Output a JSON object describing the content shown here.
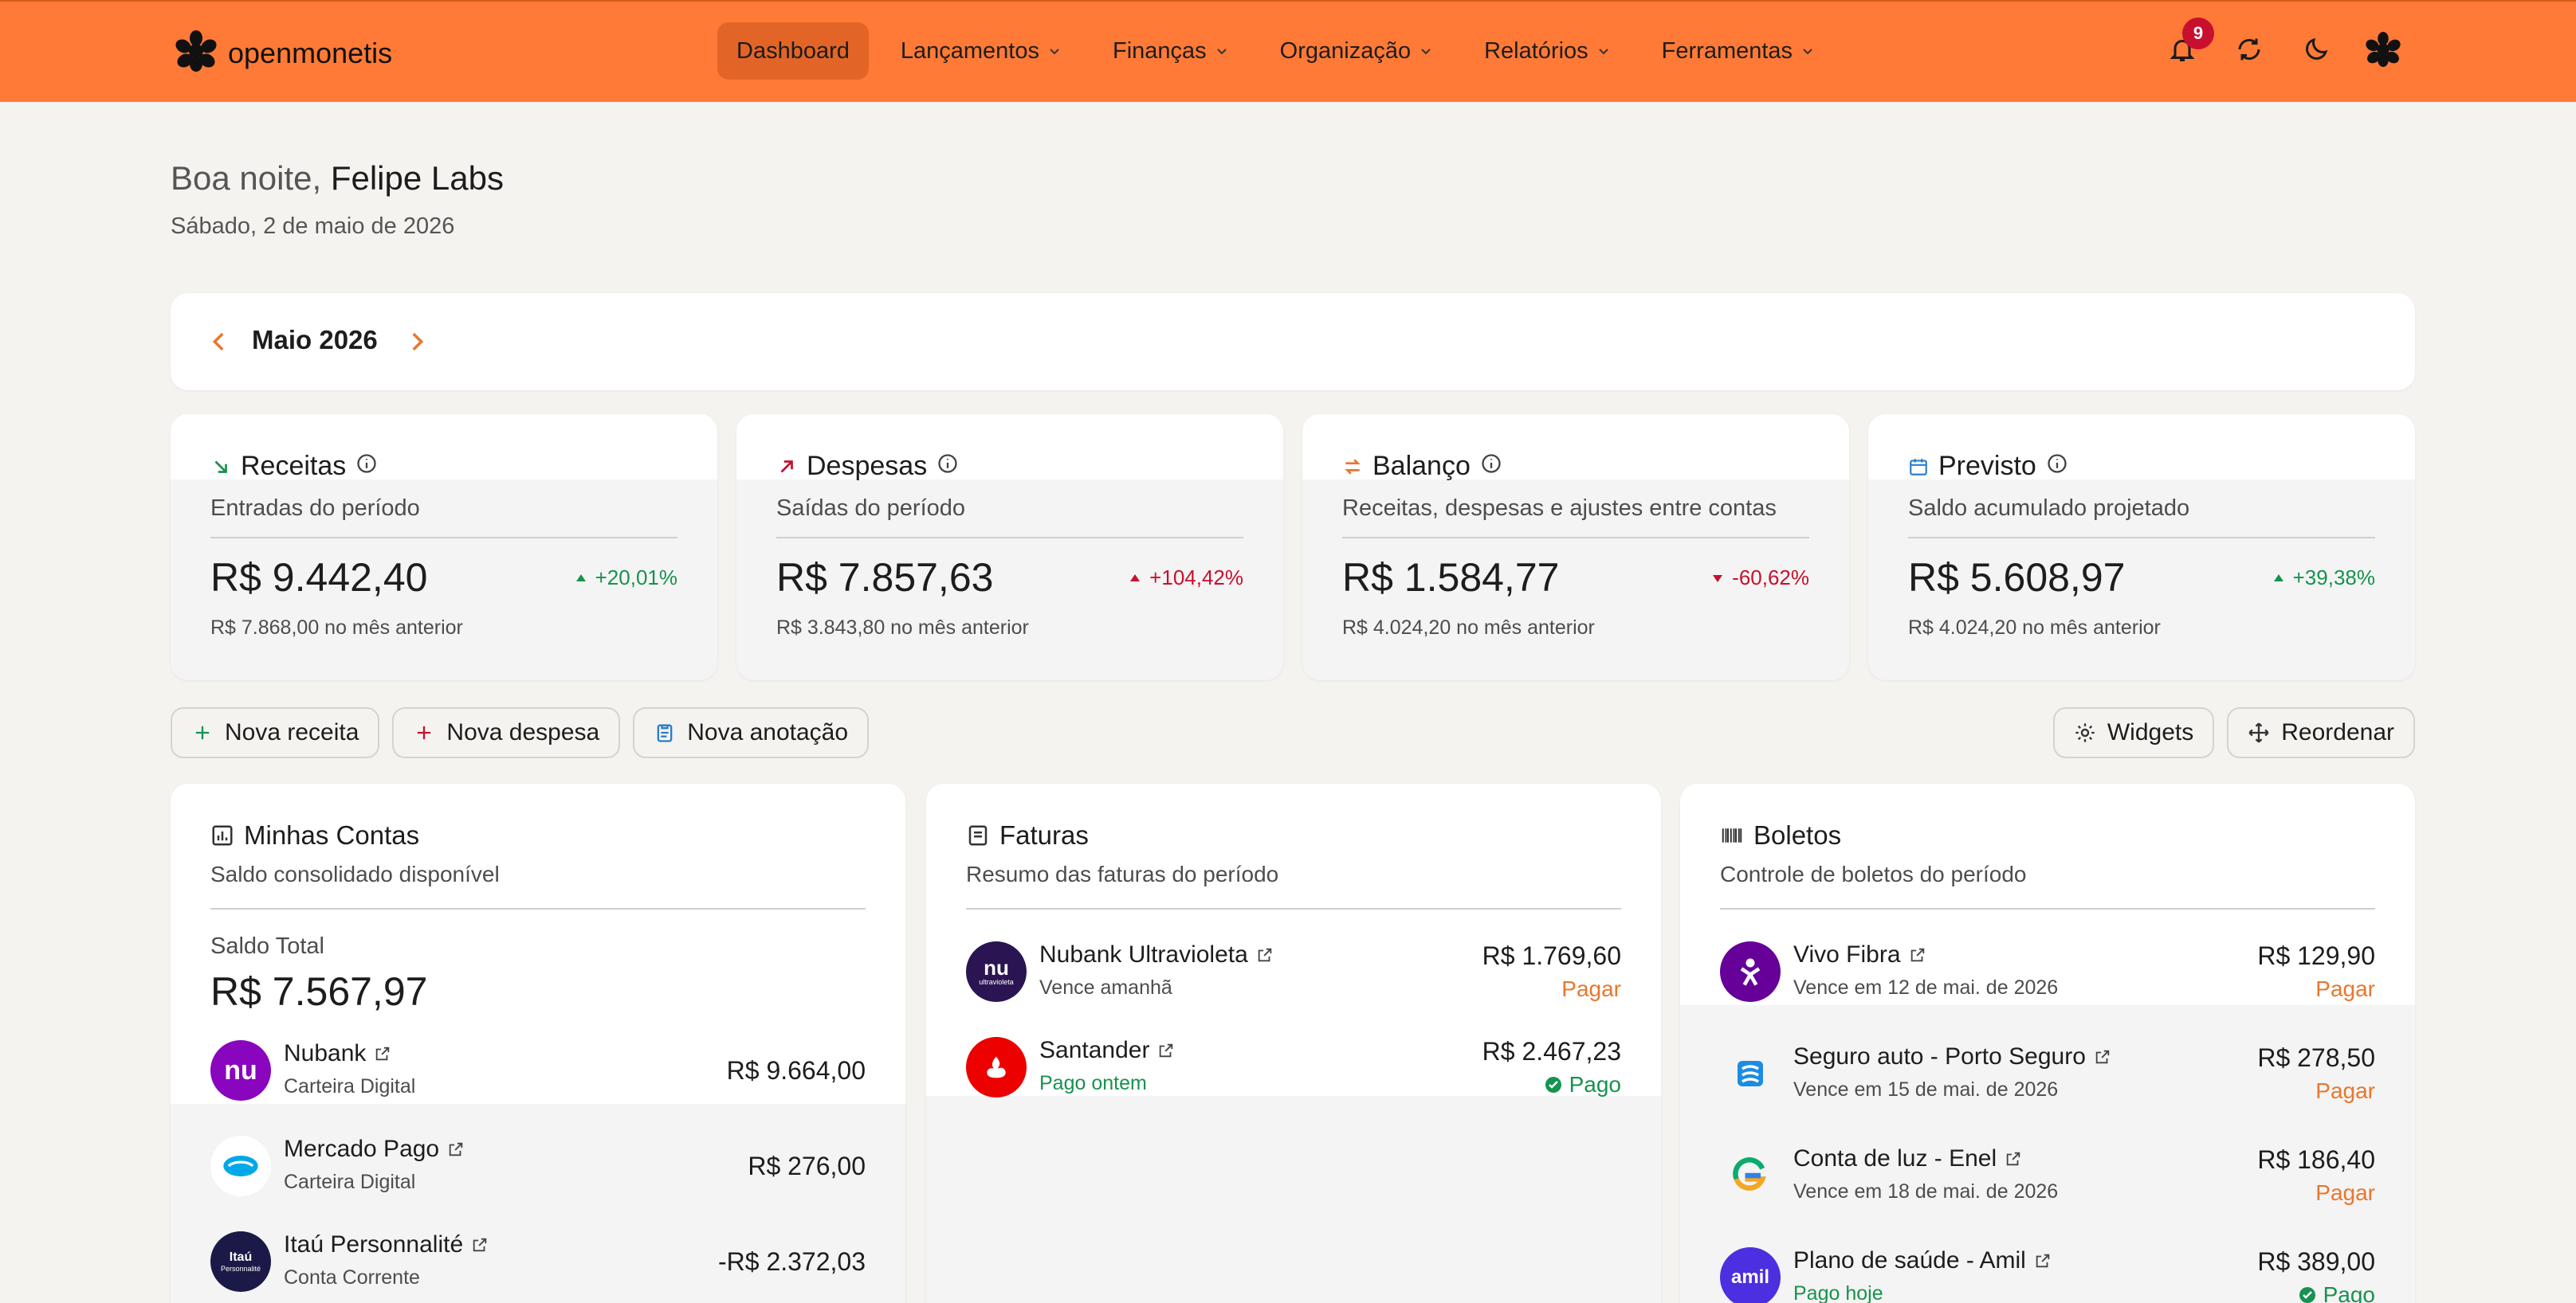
{
  "brand": {
    "name": "openmonetis"
  },
  "nav": {
    "items": [
      {
        "label": "Dashboard"
      },
      {
        "label": "Lançamentos"
      },
      {
        "label": "Finanças"
      },
      {
        "label": "Organização"
      },
      {
        "label": "Relatórios"
      },
      {
        "label": "Ferramentas"
      }
    ]
  },
  "top_icons": {
    "notifications_count": "9",
    "icons": [
      "bell-icon",
      "refresh-icon",
      "moon-icon",
      "logo-icon"
    ]
  },
  "greeting": {
    "prefix": "Boa noite,",
    "name": "Felipe Labs",
    "date": "Sábado, 2 de maio de 2026"
  },
  "month": {
    "label": "Maio 2026"
  },
  "cards": [
    {
      "title": "Receitas",
      "subtitle": "Entradas do período",
      "value": "R$ 9.442,40",
      "delta": "+20,01%",
      "prev": "R$ 7.868,00 no mês anterior"
    },
    {
      "title": "Despesas",
      "subtitle": "Saídas do período",
      "value": "R$ 7.857,63",
      "delta": "+104,42%",
      "prev": "R$ 3.843,80 no mês anterior"
    },
    {
      "title": "Balanço",
      "subtitle": "Receitas, despesas e ajustes entre contas",
      "value": "R$ 1.584,77",
      "delta": "-60,62%",
      "prev": "R$ 4.024,20 no mês anterior"
    },
    {
      "title": "Previsto",
      "subtitle": "Saldo acumulado projetado",
      "value": "R$ 5.608,97",
      "delta": "+39,38%",
      "prev": "R$ 4.024,20 no mês anterior"
    }
  ],
  "actions": {
    "nova_receita": "Nova receita",
    "nova_despesa": "Nova despesa",
    "nova_anotacao": "Nova anotação",
    "widgets": "Widgets",
    "reordenar": "Reordenar"
  },
  "contas": {
    "title": "Minhas Contas",
    "subtitle": "Saldo consolidado disponível",
    "total_label": "Saldo Total",
    "total_value": "R$ 7.567,97",
    "items": [
      {
        "name": "Nubank",
        "type": "Carteira Digital",
        "amount": "R$ 9.664,00",
        "logo": "nu"
      },
      {
        "name": "Mercado Pago",
        "type": "Carteira Digital",
        "amount": "R$ 276,00"
      },
      {
        "name": "Itaú Personnalité",
        "type": "Conta Corrente",
        "amount": "-R$ 2.372,03",
        "logo": "Itaú",
        "logo_sub": "Personnalité"
      }
    ]
  },
  "faturas": {
    "title": "Faturas",
    "subtitle": "Resumo das faturas do período",
    "items": [
      {
        "name": "Nubank Ultravioleta",
        "desc": "Vence amanhã",
        "amount": "R$ 1.769,60",
        "action": "Pagar",
        "logo": "nu",
        "logo_sub": "ultravioleta"
      },
      {
        "name": "Santander",
        "desc": "Pago ontem",
        "amount": "R$ 2.467,23",
        "action": "Pago"
      }
    ]
  },
  "boletos": {
    "title": "Boletos",
    "subtitle": "Controle de boletos do período",
    "items": [
      {
        "name": "Vivo Fibra",
        "desc": "Vence em 12 de mai. de 2026",
        "amount": "R$ 129,90",
        "action": "Pagar"
      },
      {
        "name": "Seguro auto - Porto Seguro",
        "desc": "Vence em 15 de mai. de 2026",
        "amount": "R$ 278,50",
        "action": "Pagar"
      },
      {
        "name": "Conta de luz - Enel",
        "desc": "Vence em 18 de mai. de 2026",
        "amount": "R$ 186,40",
        "action": "Pagar"
      },
      {
        "name": "Plano de saúde - Amil",
        "desc": "Pago hoje",
        "amount": "R$ 389,00",
        "action": "Pago",
        "logo": "amil"
      }
    ]
  },
  "colors": {
    "accent": "#ff7a36",
    "positive": "#17924f",
    "negative": "#c8102e",
    "pay": "#e8772e"
  }
}
